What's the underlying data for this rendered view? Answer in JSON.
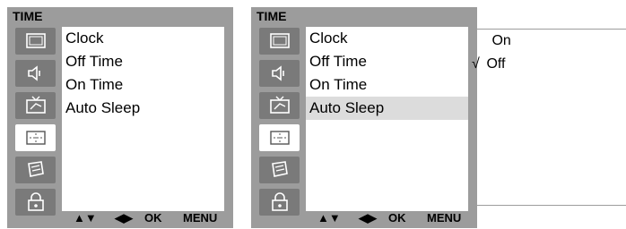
{
  "left_menu": {
    "title": "TIME",
    "items": [
      {
        "label": "Clock"
      },
      {
        "label": "Off Time"
      },
      {
        "label": "On Time"
      },
      {
        "label": "Auto Sleep"
      }
    ],
    "legend": {
      "updown": "▲▼",
      "leftright": "◀▶",
      "ok": "OK",
      "menu": "MENU"
    }
  },
  "right_menu": {
    "title": "TIME",
    "items": [
      {
        "label": "Clock"
      },
      {
        "label": "Off Time"
      },
      {
        "label": "On Time"
      },
      {
        "label": "Auto Sleep"
      }
    ],
    "selected_item": "Auto Sleep",
    "legend": {
      "updown": "▲▼",
      "leftright": "◀▶",
      "ok": "OK",
      "menu": "MENU"
    }
  },
  "submenu": {
    "options": [
      {
        "label": "On",
        "check": ""
      },
      {
        "label": "Off",
        "check": "√"
      }
    ]
  },
  "tabs": [
    {
      "icon": "picture-icon",
      "active": false
    },
    {
      "icon": "sound-icon",
      "active": false
    },
    {
      "icon": "channel-icon",
      "active": false
    },
    {
      "icon": "time-icon",
      "active": true
    },
    {
      "icon": "special-icon",
      "active": false
    },
    {
      "icon": "lock-icon",
      "active": false
    }
  ]
}
